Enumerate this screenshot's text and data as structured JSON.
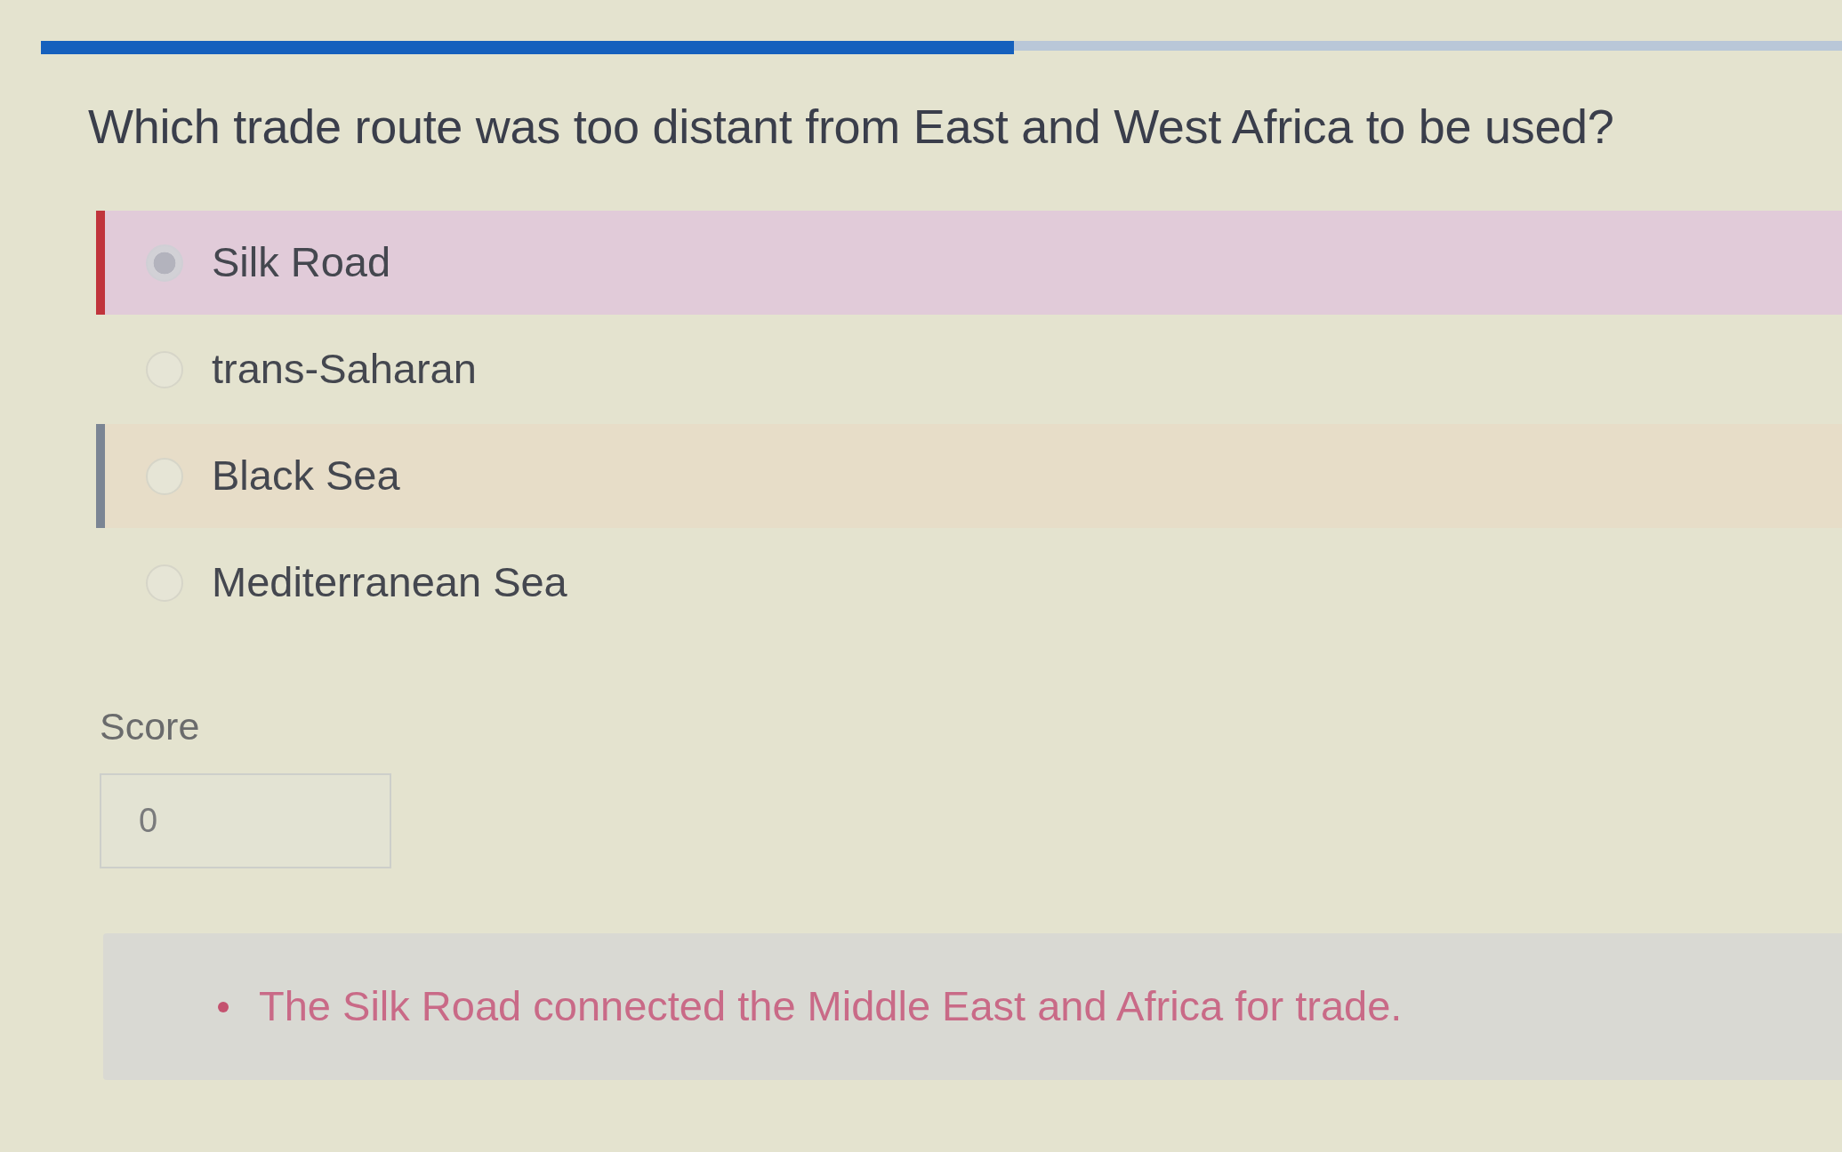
{
  "progress": {
    "level": 0.54
  },
  "question": "Which trade route was too distant from East and West Africa to be used?",
  "options": [
    {
      "label": "Silk Road",
      "selected": true,
      "incorrect": true,
      "correct": false
    },
    {
      "label": "trans-Saharan",
      "selected": false,
      "incorrect": false,
      "correct": false
    },
    {
      "label": "Black Sea",
      "selected": false,
      "incorrect": false,
      "correct": true
    },
    {
      "label": "Mediterranean Sea",
      "selected": false,
      "incorrect": false,
      "correct": false
    }
  ],
  "score": {
    "label": "Score",
    "value": "0"
  },
  "feedback": {
    "items": [
      "The Silk Road connected the Middle East and Africa for trade."
    ]
  }
}
